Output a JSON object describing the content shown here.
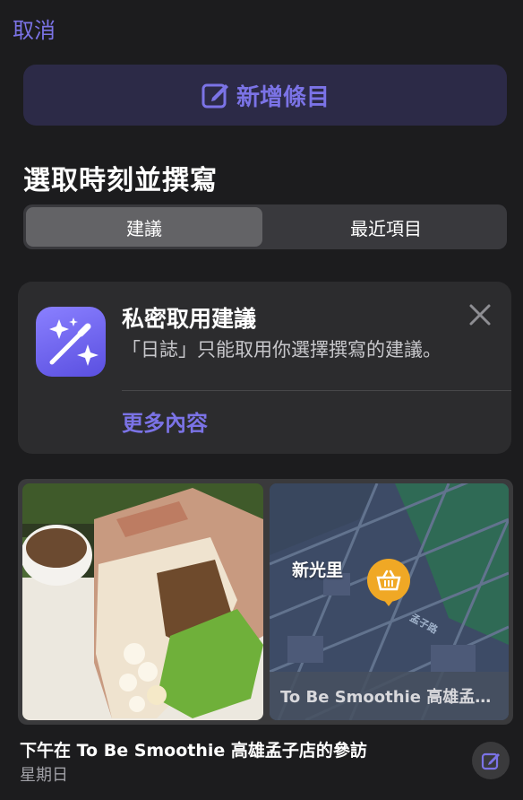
{
  "nav": {
    "cancel_label": "取消"
  },
  "new_entry": {
    "label": "新增條目",
    "icon": "compose-icon"
  },
  "section": {
    "title": "選取時刻並撰寫"
  },
  "segments": [
    {
      "label": "建議",
      "active": true
    },
    {
      "label": "最近項目",
      "active": false
    }
  ],
  "privacy_card": {
    "title": "私密取用建議",
    "body": "「日誌」只能取用你選擇撰寫的建議。",
    "more_label": "更多內容",
    "icon": "magic-wand-sparkles-icon"
  },
  "moment": {
    "map_label": "新光里",
    "map_caption": "To Be Smoothie 高雄孟…",
    "map_road": "孟子路",
    "title": "下午在 To Be Smoothie 高雄孟子店的參訪",
    "subtitle": "星期日"
  },
  "colors": {
    "accent": "#7b73e6",
    "background": "#1c1c1e",
    "card": "#2c2c2e",
    "pin": "#f0a825"
  }
}
